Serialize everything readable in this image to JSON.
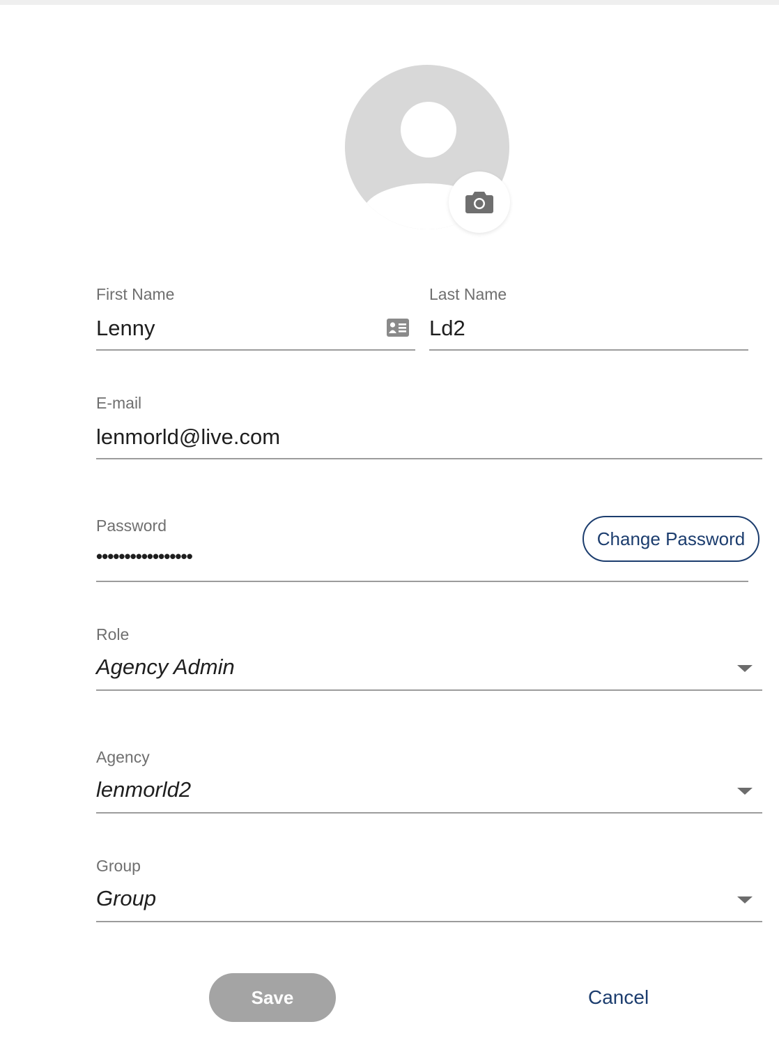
{
  "avatar": {
    "icon": "user-avatar-placeholder-icon",
    "camera_icon": "camera-icon"
  },
  "form": {
    "first_name": {
      "label": "First Name",
      "value": "Lenny",
      "icon": "contact-card-icon"
    },
    "last_name": {
      "label": "Last Name",
      "value": "Ld2"
    },
    "email": {
      "label": "E-mail",
      "value": "lenmorld@live.com"
    },
    "password": {
      "label": "Password",
      "value": "•••••••••••••••••",
      "change_label": "Change Password"
    },
    "role": {
      "label": "Role",
      "value": "Agency Admin"
    },
    "agency": {
      "label": "Agency",
      "value": "lenmorld2"
    },
    "group": {
      "label": "Group",
      "value": "Group"
    }
  },
  "actions": {
    "save_label": "Save",
    "cancel_label": "Cancel"
  },
  "colors": {
    "accent": "#1c3d6e",
    "avatar_gray": "#d8d8d8",
    "save_disabled": "#a4a4a4",
    "underline": "#9c9c9c",
    "label": "#6f6f6f"
  }
}
